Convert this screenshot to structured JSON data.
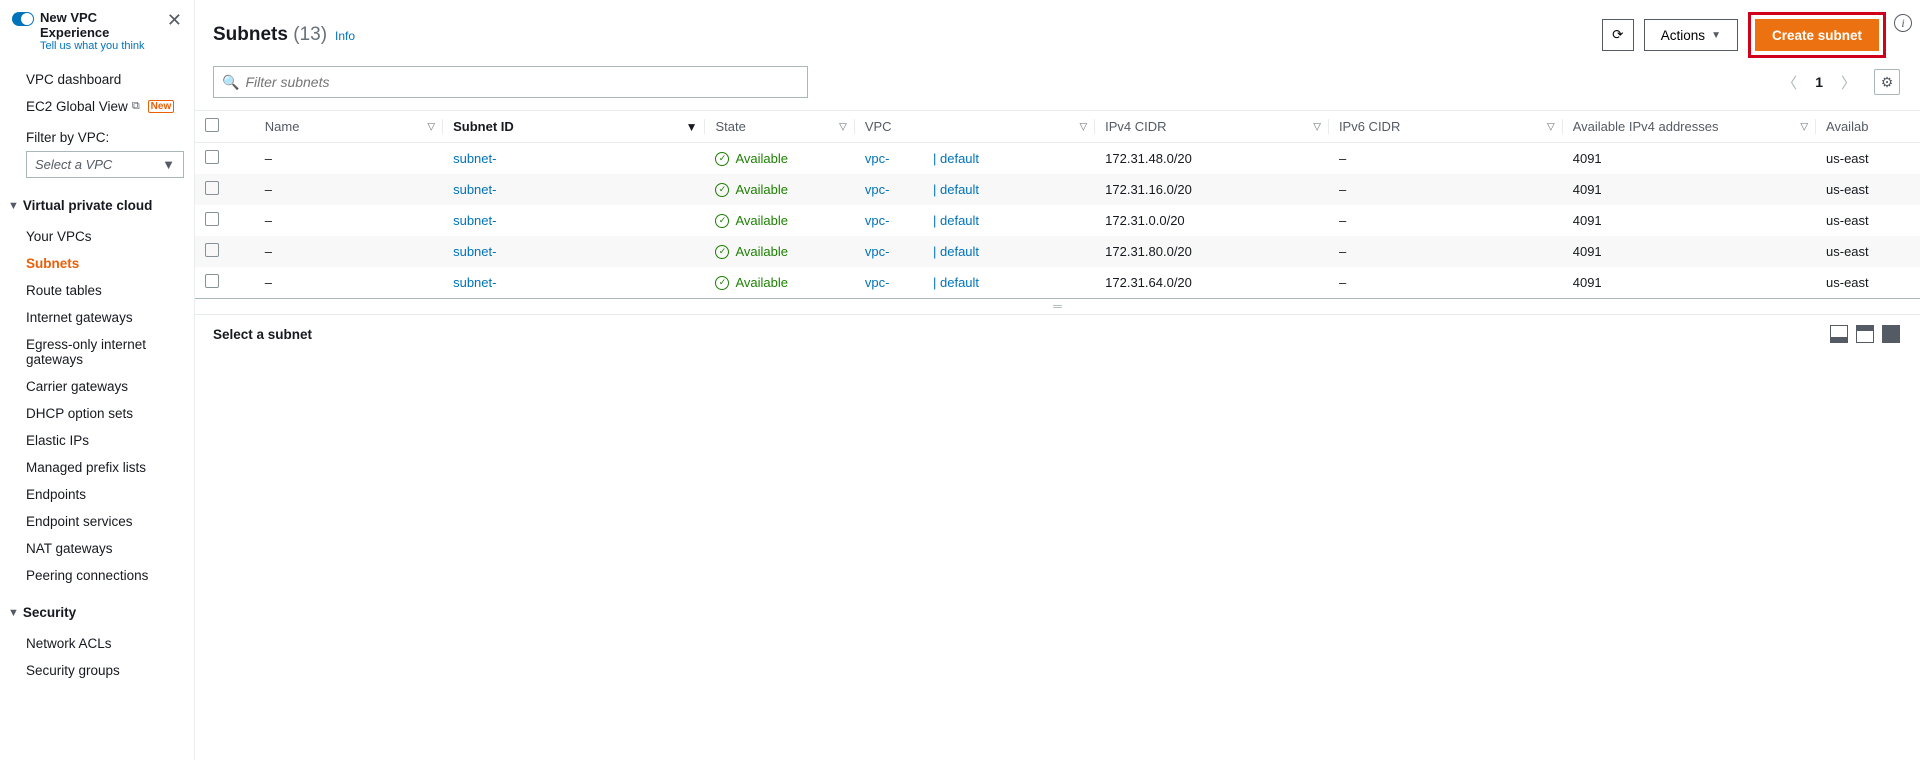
{
  "sidebar": {
    "new_vpc": {
      "title": "New VPC Experience",
      "subtitle": "Tell us what you think"
    },
    "links_top": [
      {
        "label": "VPC dashboard"
      },
      {
        "label": "EC2 Global View",
        "external": true,
        "new": "New"
      }
    ],
    "filter_label": "Filter by VPC:",
    "filter_placeholder": "Select a VPC",
    "sections": [
      {
        "title": "Virtual private cloud",
        "items": [
          {
            "label": "Your VPCs"
          },
          {
            "label": "Subnets",
            "active": true
          },
          {
            "label": "Route tables"
          },
          {
            "label": "Internet gateways"
          },
          {
            "label": "Egress-only internet gateways"
          },
          {
            "label": "Carrier gateways"
          },
          {
            "label": "DHCP option sets"
          },
          {
            "label": "Elastic IPs"
          },
          {
            "label": "Managed prefix lists"
          },
          {
            "label": "Endpoints"
          },
          {
            "label": "Endpoint services"
          },
          {
            "label": "NAT gateways"
          },
          {
            "label": "Peering connections"
          }
        ]
      },
      {
        "title": "Security",
        "items": [
          {
            "label": "Network ACLs"
          },
          {
            "label": "Security groups"
          }
        ]
      }
    ]
  },
  "header": {
    "title": "Subnets",
    "count": "(13)",
    "info": "Info",
    "refresh": "⟳",
    "actions": "Actions",
    "create": "Create subnet"
  },
  "filter": {
    "placeholder": "Filter subnets"
  },
  "pagination": {
    "page": "1"
  },
  "columns": [
    "Name",
    "Subnet ID",
    "State",
    "VPC",
    "IPv4 CIDR",
    "IPv6 CIDR",
    "Available IPv4 addresses",
    "Availab"
  ],
  "state_label": "Available",
  "rows": [
    {
      "name": "–",
      "subnet": "subnet-",
      "vpc": "vpc-",
      "vpc_suffix": " | default",
      "cidr4": "172.31.48.0/20",
      "cidr6": "–",
      "avail": "4091",
      "az": "us-east"
    },
    {
      "name": "–",
      "subnet": "subnet-",
      "vpc": "vpc-",
      "vpc_suffix": " | default",
      "cidr4": "172.31.16.0/20",
      "cidr6": "–",
      "avail": "4091",
      "az": "us-east"
    },
    {
      "name": "–",
      "subnet": "subnet-",
      "vpc": "vpc-",
      "vpc_suffix": " | default",
      "cidr4": "172.31.0.0/20",
      "cidr6": "–",
      "avail": "4091",
      "az": "us-east"
    },
    {
      "name": "–",
      "subnet": "subnet-",
      "vpc": "vpc-",
      "vpc_suffix": " | default",
      "cidr4": "172.31.80.0/20",
      "cidr6": "–",
      "avail": "4091",
      "az": "us-east"
    },
    {
      "name": "–",
      "subnet": "subnet-",
      "vpc": "vpc-",
      "vpc_suffix": " | default",
      "cidr4": "172.31.64.0/20",
      "cidr6": "–",
      "avail": "4091",
      "az": "us-east"
    }
  ],
  "detail": {
    "title": "Select a subnet"
  }
}
